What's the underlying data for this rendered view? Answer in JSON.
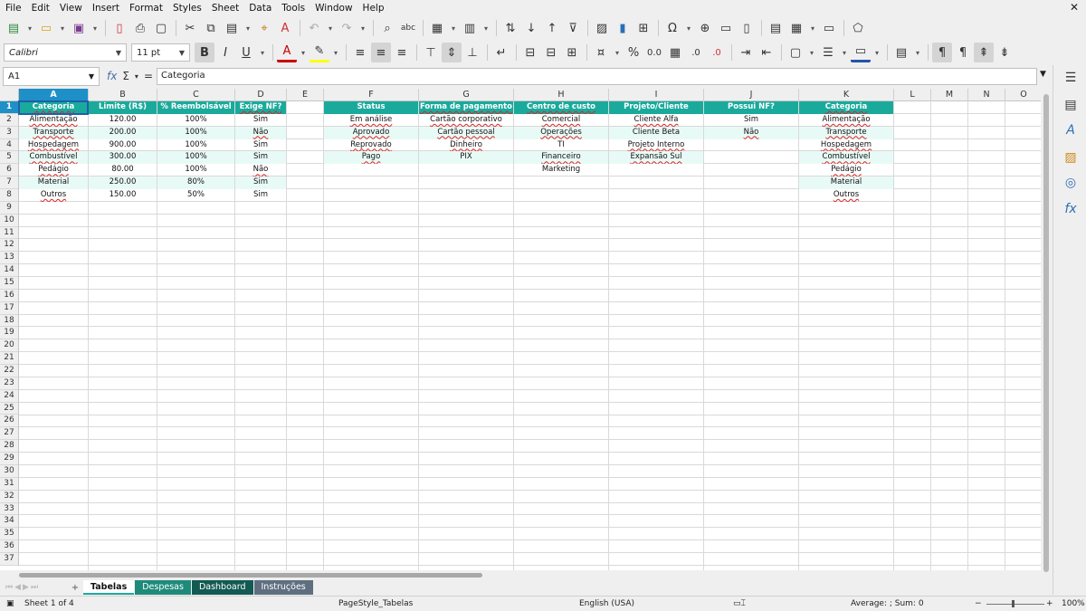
{
  "menu": [
    "File",
    "Edit",
    "View",
    "Insert",
    "Format",
    "Styles",
    "Sheet",
    "Data",
    "Tools",
    "Window",
    "Help"
  ],
  "font": {
    "name": "Calibri",
    "size": "11 pt"
  },
  "namebox": "A1",
  "formula_content": "Categoria",
  "columns": [
    "A",
    "B",
    "C",
    "D",
    "E",
    "F",
    "G",
    "H",
    "I",
    "J",
    "K",
    "L",
    "M",
    "N",
    "O"
  ],
  "rows": [
    "1",
    "2",
    "3",
    "4",
    "5",
    "6",
    "7",
    "8",
    "9",
    "10",
    "11",
    "12",
    "13",
    "14",
    "15",
    "16",
    "17",
    "18",
    "19",
    "20",
    "21",
    "22",
    "23",
    "24",
    "25",
    "26",
    "27",
    "28",
    "29",
    "30",
    "31",
    "32",
    "33",
    "34",
    "35",
    "36",
    "37"
  ],
  "table1": {
    "headers": [
      "Categoria",
      "Limite (R$)",
      "% Reembolsável",
      "Exige NF?"
    ],
    "rows": [
      [
        "Alimentação",
        "120.00",
        "100%",
        "Sim"
      ],
      [
        "Transporte",
        "200.00",
        "100%",
        "Não"
      ],
      [
        "Hospedagem",
        "900.00",
        "100%",
        "Sim"
      ],
      [
        "Combustível",
        "300.00",
        "100%",
        "Sim"
      ],
      [
        "Pedágio",
        "80.00",
        "100%",
        "Não"
      ],
      [
        "Material",
        "250.00",
        "80%",
        "Sim"
      ],
      [
        "Outros",
        "150.00",
        "50%",
        "Sim"
      ]
    ]
  },
  "lists": {
    "headers": [
      "Status",
      "Forma de pagamento",
      "Centro de custo",
      "Projeto/Cliente",
      "Possui NF?",
      "Categoria"
    ],
    "Status": [
      "Em análise",
      "Aprovado",
      "Reprovado",
      "Pago"
    ],
    "Forma de pagamento": [
      "Cartão corporativo",
      "Cartão pessoal",
      "Dinheiro",
      "PIX"
    ],
    "Centro de custo": [
      "Comercial",
      "Operações",
      "TI",
      "Financeiro",
      "Marketing"
    ],
    "Projeto/Cliente": [
      "Cliente Alfa",
      "Cliente Beta",
      "Projeto Interno",
      "Expansão Sul"
    ],
    "Possui NF?": [
      "Sim",
      "Não"
    ],
    "Categoria": [
      "Alimentação",
      "Transporte",
      "Hospedagem",
      "Combustível",
      "Pedágio",
      "Material",
      "Outros"
    ]
  },
  "sheet_tabs": [
    "Tabelas",
    "Despesas",
    "Dashboard",
    "Instruções"
  ],
  "active_tab": "Tabelas",
  "tab_colors": {
    "Tabelas": "#ffffff",
    "Despesas": "#1e8a7a",
    "Dashboard": "#125a52",
    "Instruções": "#5f6f80"
  },
  "status": {
    "sheet": "Sheet 1 of 4",
    "page_style": "PageStyle_Tabelas",
    "language": "English (USA)",
    "sum": "Average: ; Sum: 0",
    "zoom": "100%"
  },
  "colors": {
    "header_teal": "#1aaa9c",
    "alt_row": "#e8faf6",
    "selection": "#1e90c7"
  }
}
